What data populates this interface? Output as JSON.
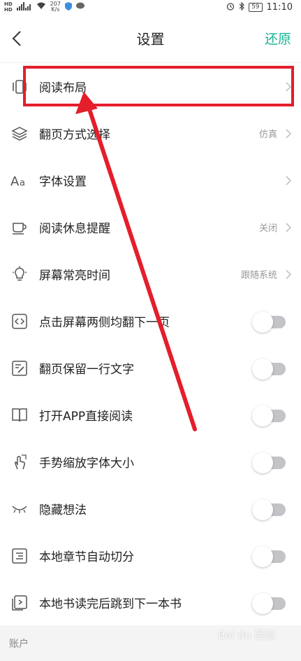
{
  "status_bar": {
    "hd1": "HD",
    "hd2": "HD",
    "net": "46",
    "speed": "207",
    "speed_unit": "K/s",
    "battery": "59",
    "time": "11:10"
  },
  "header": {
    "title": "设置",
    "restore_label": "还原"
  },
  "settings": {
    "rows": [
      {
        "label": "阅读布局",
        "value": ""
      },
      {
        "label": "翻页方式选择",
        "value": "仿真"
      },
      {
        "label": "字体设置",
        "value": ""
      },
      {
        "label": "阅读休息提醒",
        "value": "关闭"
      },
      {
        "label": "屏幕常亮时间",
        "value": "跟随系统"
      },
      {
        "label": "点击屏幕两侧均翻下一页",
        "toggle": false
      },
      {
        "label": "翻页保留一行文字",
        "toggle": false
      },
      {
        "label": "打开APP直接阅读",
        "toggle": false
      },
      {
        "label": "手势缩放字体大小",
        "toggle": false
      },
      {
        "label": "隐藏想法",
        "toggle": false
      },
      {
        "label": "本地章节自动切分",
        "toggle": false
      },
      {
        "label": "本地书读完后跳到下一本书",
        "toggle": false
      }
    ]
  },
  "footer": {
    "section_label": "账户"
  },
  "watermark": "Bai du 经验",
  "colors": {
    "accent": "#1ab394",
    "annotation_red": "#e41e2b",
    "toggle_off": "#c4c4c8"
  }
}
